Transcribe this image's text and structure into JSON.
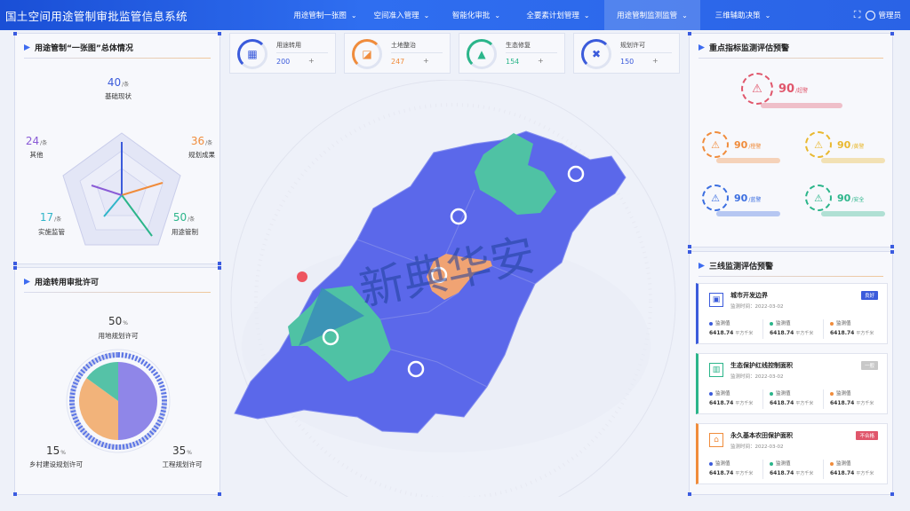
{
  "app": {
    "title": "国土空间用途管制审批监管信息系统"
  },
  "nav": {
    "items": [
      {
        "label": "用途管制一张图"
      },
      {
        "label": "空间准入管理"
      },
      {
        "label": "智能化审批"
      },
      {
        "label": "全要素计划管理"
      },
      {
        "label": "用途管制监测监管"
      },
      {
        "label": "三维辅助决策"
      }
    ],
    "active_index": 4,
    "user": "管理员"
  },
  "overview": {
    "title": "用途管制“一张图”总体情况",
    "unit": "/条",
    "items": [
      {
        "label": "基础现状",
        "value": "40",
        "color": "#3b5bdb"
      },
      {
        "label": "规划成果",
        "value": "36",
        "color": "#f08c3c"
      },
      {
        "label": "用途管制",
        "value": "50",
        "color": "#2bb58a"
      },
      {
        "label": "实施监管",
        "value": "17",
        "color": "#2fb5c9"
      },
      {
        "label": "其他",
        "value": "24",
        "color": "#8a5bd6"
      }
    ]
  },
  "approval": {
    "title": "用途转用审批许可",
    "unit": "%",
    "items": [
      {
        "label": "用地规划许可",
        "value": "50",
        "share": 0.5,
        "color": "#8f86e8"
      },
      {
        "label": "工程规划许可",
        "value": "35",
        "share": 0.35,
        "color": "#f2b37a"
      },
      {
        "label": "乡村建设规划许可",
        "value": "15",
        "share": 0.15,
        "color": "#55c2a7"
      }
    ]
  },
  "stats": [
    {
      "name": "用途转用",
      "value": "200",
      "plus": "+",
      "color": "#3b5bdb",
      "glyph": "▦"
    },
    {
      "name": "土地整治",
      "value": "247",
      "plus": "+",
      "color": "#f08c3c",
      "glyph": "◪"
    },
    {
      "name": "生态修复",
      "value": "154",
      "plus": "+",
      "color": "#2bb58a",
      "glyph": "▲"
    },
    {
      "name": "规划许可",
      "value": "150",
      "plus": "+",
      "color": "#3b5bdb",
      "glyph": "✖"
    }
  ],
  "map": {
    "watermark": "新典华安"
  },
  "key_indicators": {
    "title": "重点指标监测评估预警",
    "items": [
      {
        "value": "90",
        "tag": "/超警",
        "color": "#e0566b"
      },
      {
        "value": "90",
        "tag": "/橙警",
        "color": "#f08c3c"
      },
      {
        "value": "90",
        "tag": "/黄警",
        "color": "#e9b82f"
      },
      {
        "value": "90",
        "tag": "/蓝警",
        "color": "#3b6ee0"
      },
      {
        "value": "90",
        "tag": "/安全",
        "color": "#2bb58a"
      }
    ]
  },
  "three_lines": {
    "title": "三线监测评估预警",
    "metric_labels": [
      "监测值",
      "监测值",
      "监测值"
    ],
    "metric_colors": [
      "#3b5bdb",
      "#2bb58a",
      "#f08c3c"
    ],
    "metric_value": "6418.74",
    "metric_unit": "平方千米",
    "date_prefix": "监测时间：",
    "cards": [
      {
        "name": "城市开发边界",
        "date": "2022-03-02",
        "tag": "良好",
        "tag_color": "#3b5bdb",
        "border": "#3b5bdb",
        "icon": "▣"
      },
      {
        "name": "生态保护红线控制面积",
        "date": "2022-03-02",
        "tag": "一般",
        "tag_color": "#c8c8c8",
        "border": "#2bb58a",
        "icon": "▥"
      },
      {
        "name": "永久基本农田保护面积",
        "date": "2022-03-02",
        "tag": "不合格",
        "tag_color": "#e0566b",
        "border": "#f08c3c",
        "icon": "⌂"
      }
    ]
  }
}
